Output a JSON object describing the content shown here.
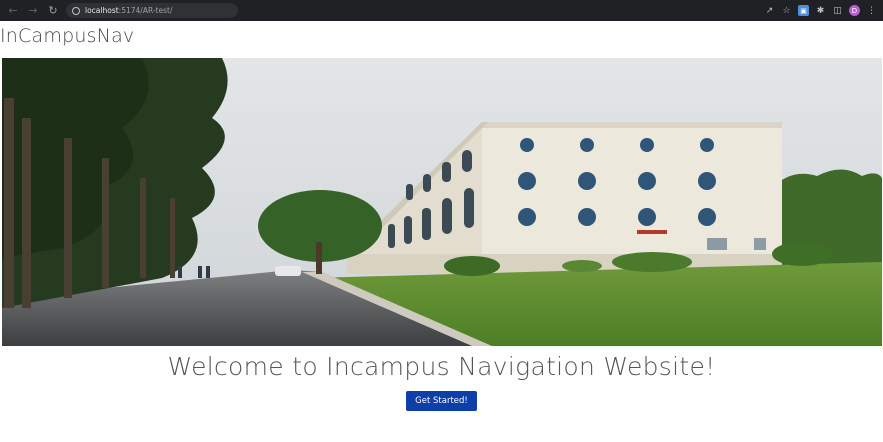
{
  "browser": {
    "url_host": "localhost",
    "url_path": ":5174/AR-test/",
    "back_icon": "arrow-left-icon",
    "forward_icon": "arrow-right-icon",
    "reload_icon": "reload-icon",
    "profile_initial": "D"
  },
  "header": {
    "brand": "InCampusNav"
  },
  "hero": {
    "image_alt": "Campus building with palm-lined road and lawn"
  },
  "main": {
    "welcome_text": "Welcome to Incampus Navigation Website!",
    "cta_label": "Get Started!"
  },
  "colors": {
    "cta": "#0d3fa8",
    "chrome": "#202124"
  }
}
